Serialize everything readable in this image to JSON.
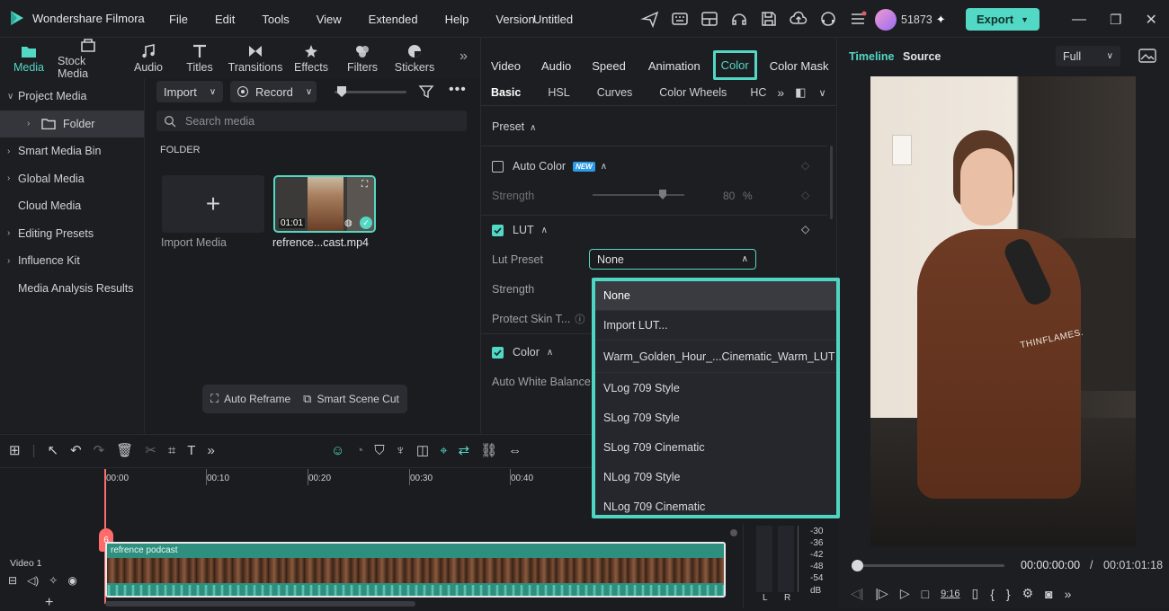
{
  "app": {
    "name": "Wondershare Filmora",
    "project": "Untitled",
    "user_count": "51873",
    "export_label": "Export"
  },
  "menu": [
    "File",
    "Edit",
    "Tools",
    "View",
    "Extended",
    "Help",
    "Version"
  ],
  "media_tabs": [
    "Media",
    "Stock Media",
    "Audio",
    "Titles",
    "Transitions",
    "Effects",
    "Filters",
    "Stickers"
  ],
  "sidebar": {
    "items": [
      {
        "label": "Project Media",
        "chev": "∨"
      },
      {
        "label": "Folder",
        "chev": "›"
      },
      {
        "label": "Smart Media Bin",
        "chev": "›"
      },
      {
        "label": "Global Media",
        "chev": "›"
      },
      {
        "label": "Cloud Media",
        "chev": ""
      },
      {
        "label": "Editing Presets",
        "chev": "›"
      },
      {
        "label": "Influence Kit",
        "chev": "›"
      },
      {
        "label": "Media Analysis Results",
        "chev": ""
      }
    ]
  },
  "media": {
    "import_label": "Import",
    "record_label": "Record",
    "search_placeholder": "Search media",
    "folder_heading": "FOLDER",
    "import_media_label": "Import Media",
    "clip_name": "refrence...cast.mp4",
    "clip_duration": "01:01",
    "auto_reframe": "Auto Reframe",
    "smart_scene_cut": "Smart Scene Cut"
  },
  "props": {
    "tabs": [
      "Video",
      "Audio",
      "Speed",
      "Animation",
      "Color",
      "Color Mask"
    ],
    "active_tab": "Color",
    "subtabs": [
      "Basic",
      "HSL",
      "Curves",
      "Color Wheels",
      "HC"
    ],
    "preset_label": "Preset",
    "auto_color_label": "Auto Color",
    "new_badge": "NEW",
    "strength_label": "Strength",
    "strength_value": "80",
    "strength_unit": "%",
    "lut_label": "LUT",
    "lut_preset_label": "Lut Preset",
    "lut_selected": "None",
    "strength2_label": "Strength",
    "protect_skin_label": "Protect Skin T...",
    "color_label": "Color",
    "auto_wb_label": "Auto White Balance"
  },
  "lut_dropdown": [
    "None",
    "Import LUT...",
    "Warm_Golden_Hour_...Cinematic_Warm_LUT",
    "VLog 709 Style",
    "SLog 709 Style",
    "SLog 709 Cinematic",
    "NLog 709 Style",
    "NLog 709 Cinematic"
  ],
  "preview": {
    "tab_timeline": "Timeline",
    "tab_source": "Source",
    "zoom": "Full",
    "current_time": "00:00:00:00",
    "total_time": "00:01:01:18",
    "divider": "/",
    "shirt_text": "THINFLAMES."
  },
  "timeline": {
    "ruler": [
      "00:00",
      "00:10",
      "00:20",
      "00:30",
      "00:40"
    ],
    "track_label": "Video 1",
    "clip_label": "refrence podcast",
    "playhead_marker": "6"
  },
  "meter": {
    "scale": [
      "-30",
      "-36",
      "-42",
      "-48",
      "-54",
      "dB"
    ],
    "left": "L",
    "right": "R"
  },
  "colors": {
    "accent": "#52d8c4",
    "bg": "#1b1c20",
    "panel": "#1d1e22",
    "clip": "#2f8f7e"
  }
}
